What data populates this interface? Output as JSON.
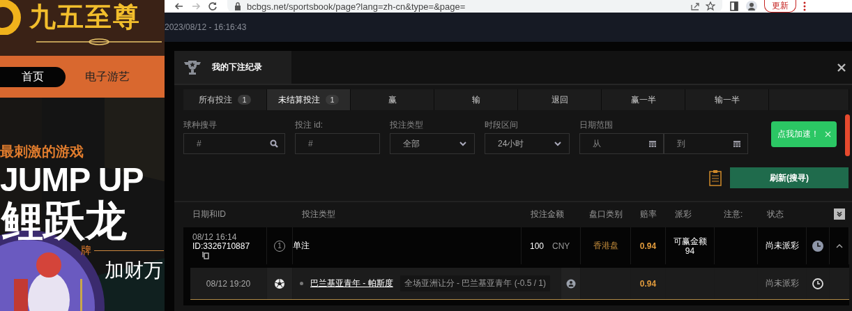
{
  "site_banner": {
    "logo_text": "九五至尊",
    "nav": [
      {
        "label": "首页",
        "selected": true
      },
      {
        "label": "电子游艺",
        "selected": false
      }
    ],
    "promo": {
      "tagline": "最刺激的游戏",
      "title": "JUMP UP",
      "subtitle": "鲤跃龙",
      "tag": "牌",
      "slogan": "加财万"
    }
  },
  "browser": {
    "url": "bcbgs.net/sportsbook/page?lang=zh-cn&type=&page=",
    "update_button": "更新"
  },
  "clock": "2023/08/12 - 16:16:43",
  "dialog": {
    "title": "我的下注纪录",
    "tabs": [
      {
        "label": "所有投注",
        "count": "1",
        "selected": false
      },
      {
        "label": "未结算投注",
        "count": "1",
        "selected": true
      },
      {
        "label": "赢",
        "selected": false
      },
      {
        "label": "输",
        "selected": false
      },
      {
        "label": "退回",
        "selected": false
      },
      {
        "label": "赢一半",
        "selected": false
      },
      {
        "label": "输一半",
        "selected": false
      }
    ],
    "filters": [
      {
        "kind": "search",
        "label": "球种搜寻",
        "placeholder": "#"
      },
      {
        "kind": "text",
        "label": "投注 id:",
        "placeholder": "#"
      },
      {
        "kind": "select",
        "label": "投注类型",
        "value": "全部"
      },
      {
        "kind": "select",
        "label": "时段区间",
        "value": "24小时"
      },
      {
        "kind": "daterange",
        "label": "日期范围",
        "from_placeholder": "从",
        "to_placeholder": "到"
      }
    ],
    "toast": "点我加速！",
    "refresh_button": "刷新(搜寻)",
    "table": {
      "columns": [
        "日期和ID",
        "投注类型",
        "投注金额",
        "盘口类别",
        "赔率",
        "派彩",
        "注意:",
        "状态"
      ],
      "rows": [
        {
          "date": "08/12 16:14",
          "id": "ID:3326710887",
          "leg_count": "1",
          "bet_type": "单注",
          "amount": "100",
          "currency": "CNY",
          "odds_type": "香港盘",
          "odds": "0.94",
          "payout_label": "可赢金额",
          "payout": "94",
          "status": "尚未派彩",
          "expanded": true,
          "legs": [
            {
              "time": "08/12 19:20",
              "match": "巴兰基亚青年 - 帕斯度",
              "market": "全场亚洲让分 - 巴兰基亚青年 (-0.5 / 1)",
              "odds": "0.94",
              "status": "尚未派彩"
            }
          ]
        }
      ]
    }
  }
}
